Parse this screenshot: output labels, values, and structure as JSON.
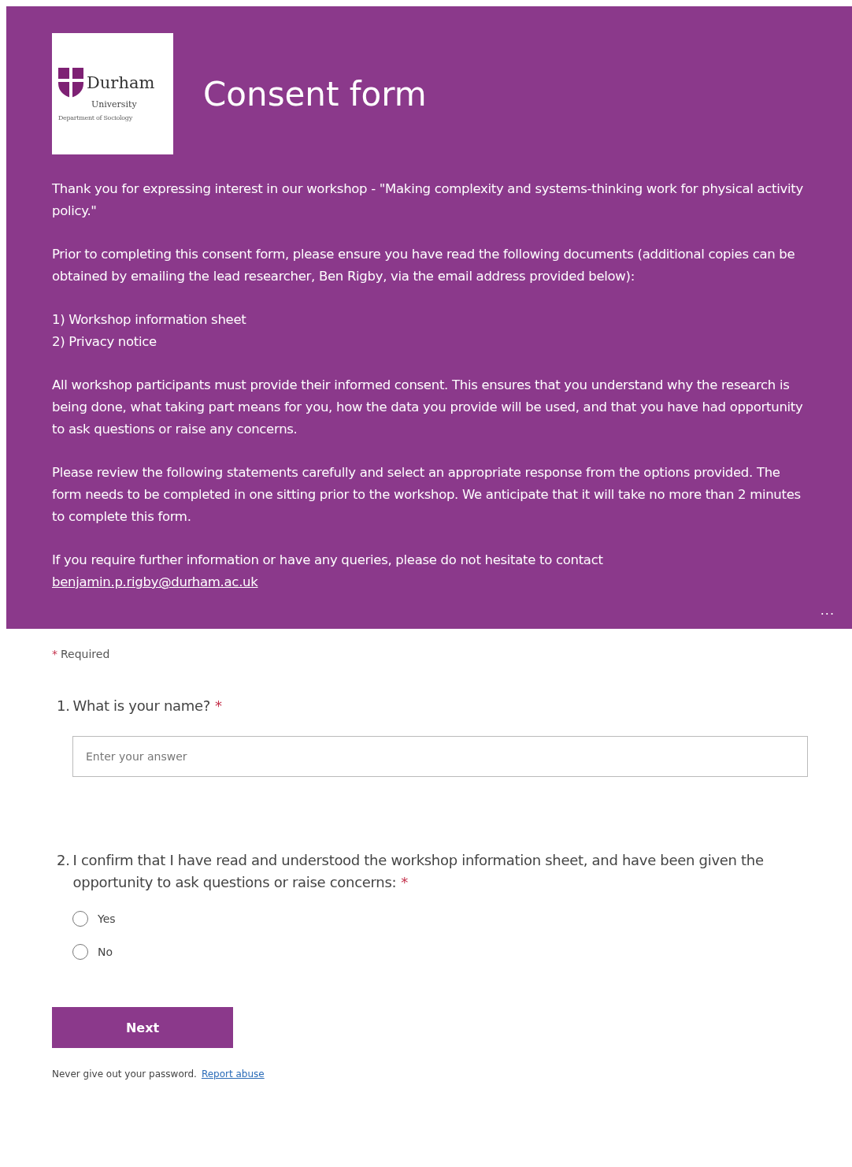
{
  "header": {
    "logo": {
      "name": "Durham",
      "subtitle": "University",
      "department": "Department of Sociology"
    },
    "title": "Consent form",
    "paragraphs": [
      {
        "kind": "text",
        "text": "Thank you for expressing interest in our workshop - \"Making complexity and systems-thinking work for physical activity policy.\""
      },
      {
        "kind": "text",
        "text": "Prior to completing this consent form, please ensure you have read the following documents (additional copies can be obtained by emailing the lead researcher, Ben Rigby, via the email address provided below):"
      },
      {
        "kind": "lines",
        "lines": [
          "1) Workshop information sheet",
          "2) Privacy notice"
        ]
      },
      {
        "kind": "text",
        "text": "All workshop participants must provide their informed consent. This ensures that you understand why the research is being done, what taking part means for you, how the data you provide will be used, and that you have had opportunity to ask questions or raise any concerns."
      },
      {
        "kind": "text",
        "text": "Please review the following statements carefully and select an appropriate response from the options provided. The form needs to be completed in one sitting prior to the workshop. We anticipate that it will take no more than 2 minutes to complete this form."
      },
      {
        "kind": "contact",
        "text": "If you require further information or have any queries, please do not hesitate to contact",
        "link": "benjamin.p.rigby@durham.ac.uk"
      }
    ],
    "more": "..."
  },
  "required_note": {
    "mark": "*",
    "label": "Required"
  },
  "questions": [
    {
      "kind": "text",
      "number": "1.",
      "text": "What is your name?",
      "required": true,
      "placeholder": "Enter your answer"
    },
    {
      "kind": "choice",
      "number": "2.",
      "text": "I confirm that I have read and understood the workshop information sheet, and have been given the opportunity to ask questions or raise concerns:",
      "required": true,
      "options": [
        {
          "label": "Yes",
          "selected": false
        },
        {
          "label": "No",
          "selected": false
        }
      ]
    }
  ],
  "next_button": "Next",
  "footer": {
    "text": "Never give out your password.",
    "link": "Report abuse"
  }
}
